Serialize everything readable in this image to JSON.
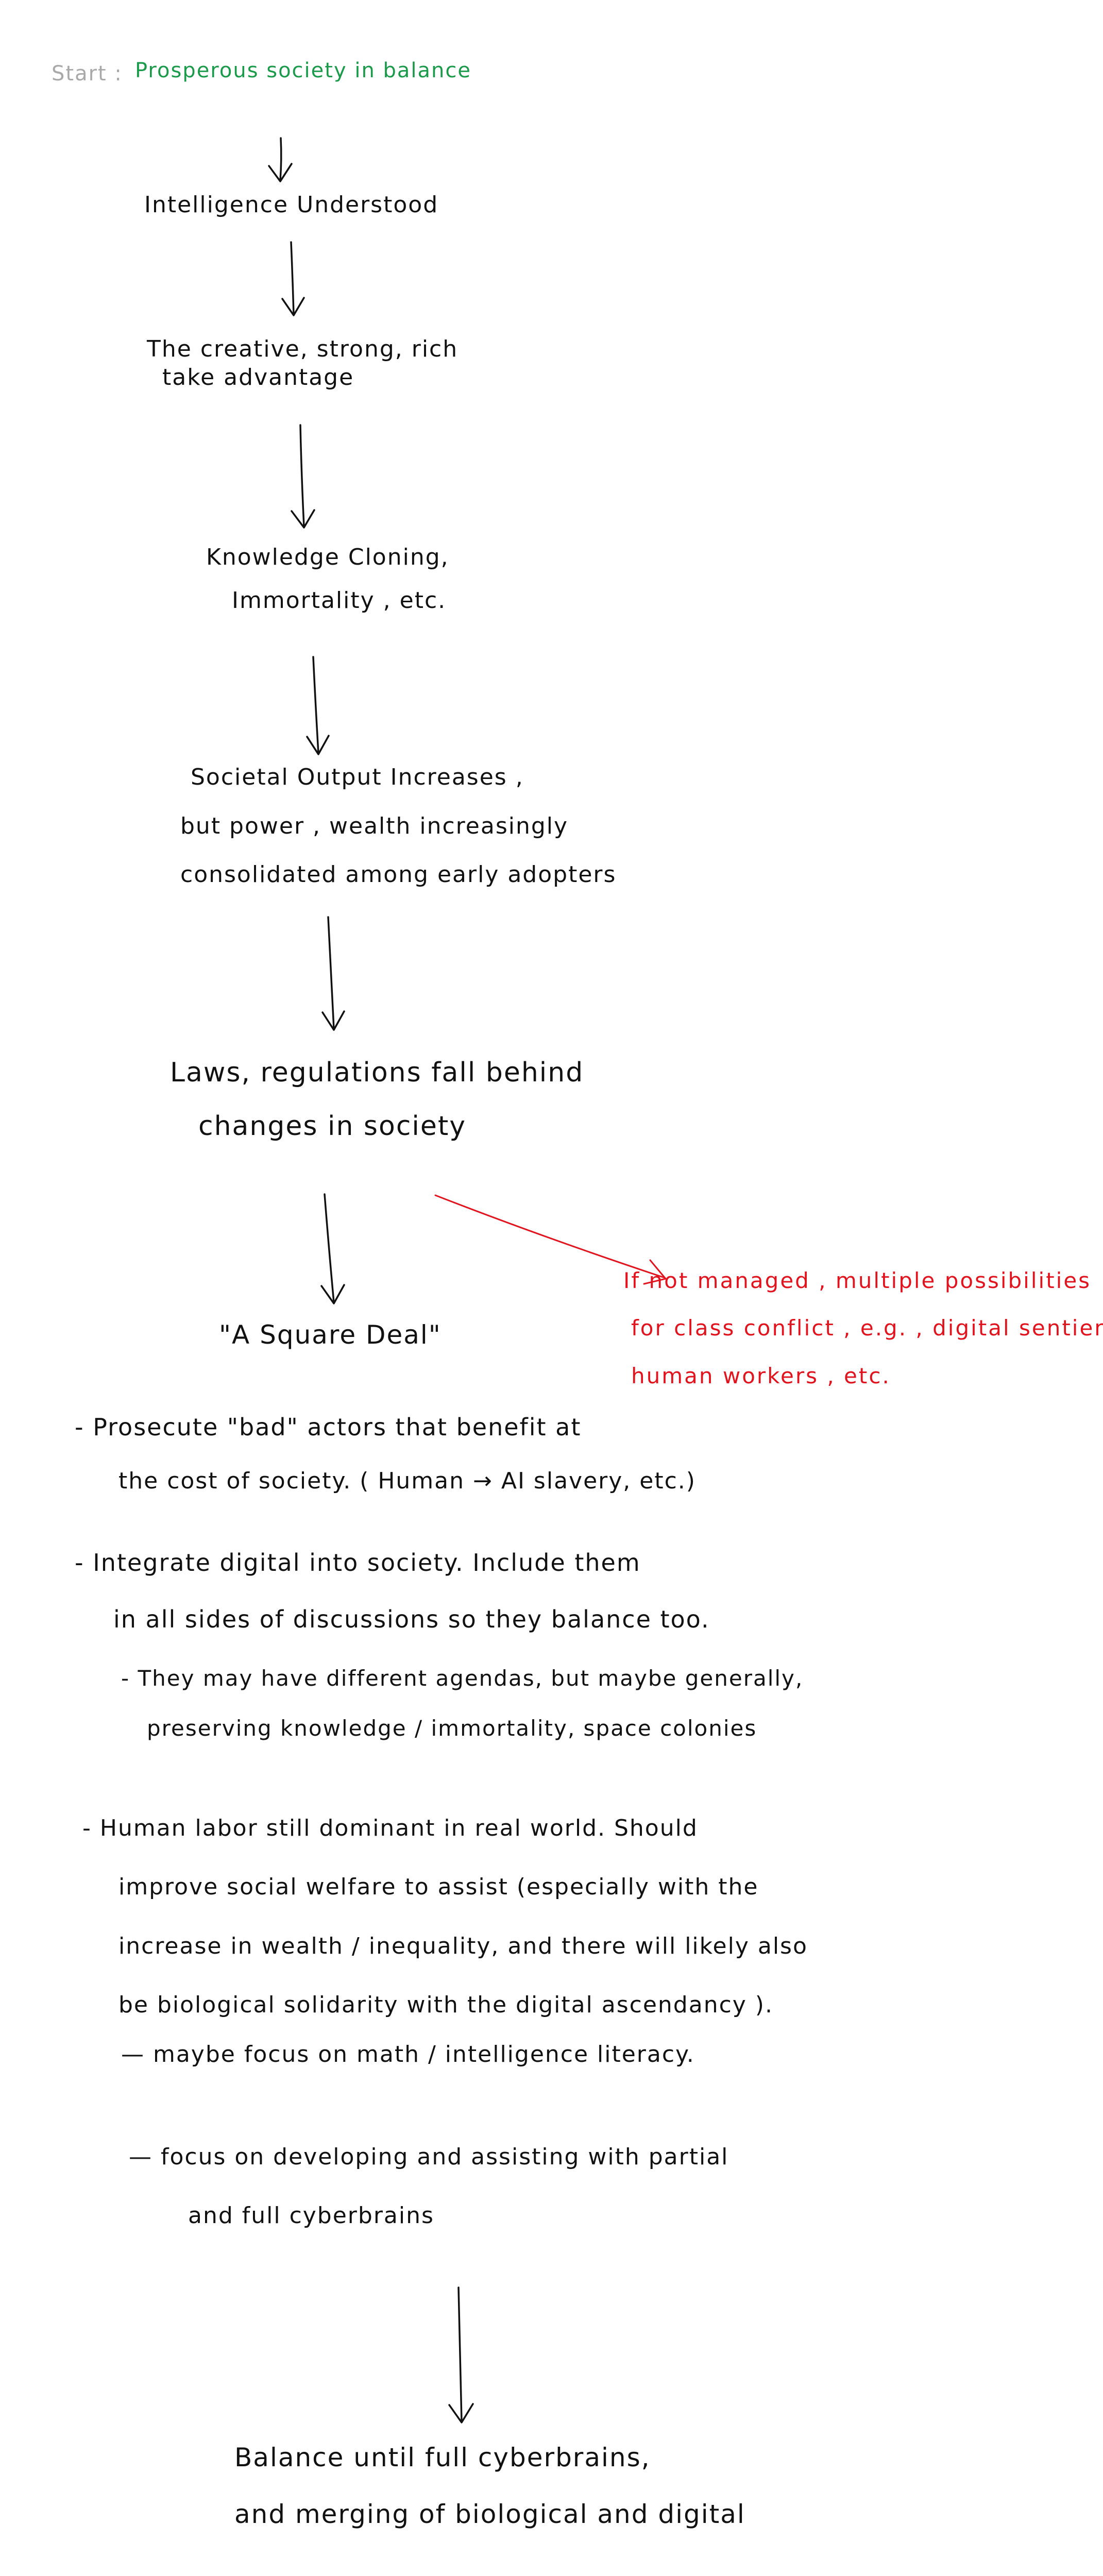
{
  "start": {
    "label": "Start :",
    "text": "Prosperous society in balance"
  },
  "steps": [
    {
      "lines": [
        "Intelligence Understood"
      ]
    },
    {
      "lines": [
        "The creative, strong, rich",
        "take advantage"
      ]
    },
    {
      "lines": [
        "Knowledge Cloning,",
        "Immortality , etc."
      ]
    },
    {
      "lines": [
        "Societal Output Increases ,",
        "but power , wealth increasingly",
        "consolidated among early adopters"
      ]
    },
    {
      "lines": [
        "Laws, regulations fall behind",
        "changes in society"
      ]
    }
  ],
  "warning": {
    "lines": [
      "If not managed , multiple possibilities",
      "for class conflict , e.g. , digital sentience ,",
      "human workers , etc."
    ]
  },
  "square_deal": {
    "title": "\"A Square Deal\"",
    "items": [
      {
        "lines": [
          "- Prosecute \"bad\" actors that benefit at",
          "the cost of society. ( Human → AI slavery, etc.)"
        ]
      },
      {
        "lines": [
          "- Integrate digital into society. Include them",
          "in all sides of discussions so they balance too."
        ]
      },
      {
        "lines": [
          "- They may have different agendas, but maybe generally,",
          "preserving knowledge / immortality, space colonies"
        ]
      },
      {
        "lines": [
          "- Human labor still dominant in real world. Should",
          "improve social welfare to assist (especially with the",
          "increase in wealth / inequality, and there will likely also",
          "be biological solidarity with the digital ascendancy )."
        ]
      },
      {
        "lines": [
          "— maybe focus on math / intelligence literacy."
        ]
      },
      {
        "lines": [
          "— focus on developing and assisting with partial",
          "and full cyberbrains"
        ]
      }
    ]
  },
  "conclusion": {
    "lines": [
      "Balance until full cyberbrains,",
      "and merging of biological and digital"
    ]
  },
  "colors": {
    "ink": "#111111",
    "start_label": "#a9a9a9",
    "start_text": "#1a9a4a",
    "warning": "#e0141e"
  }
}
